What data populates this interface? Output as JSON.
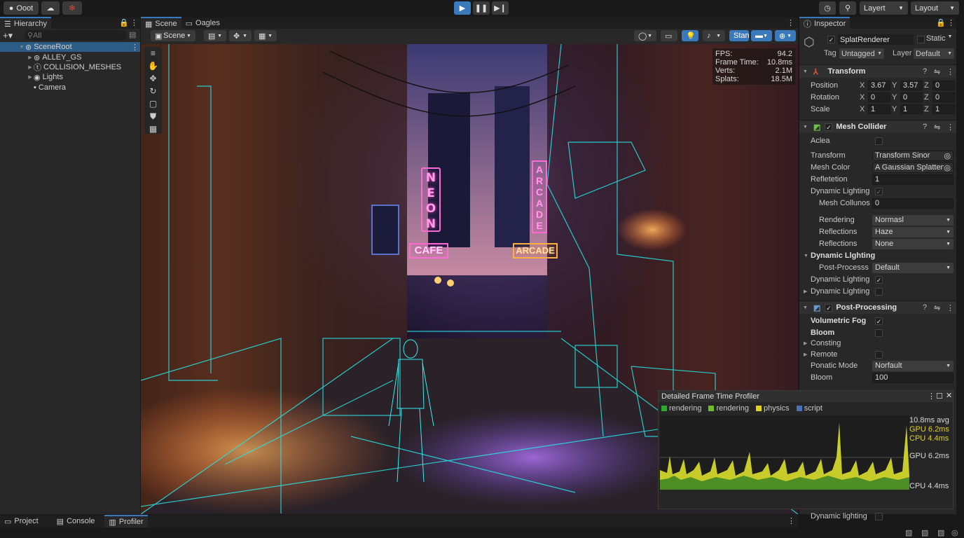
{
  "topbar": {
    "logo": "Ooot",
    "layer_dd": "Layert",
    "layout_dd": "Layout"
  },
  "hierarchy": {
    "tab": "Hierarchy",
    "search_placeholder": "All",
    "items": [
      {
        "label": "SceneRoot"
      },
      {
        "label": "ALLEY_GS"
      },
      {
        "label": "COLLISION_MESHES"
      },
      {
        "label": "Lights"
      },
      {
        "label": "Camera"
      }
    ]
  },
  "scene": {
    "tabs": [
      "Scene",
      "Oagles"
    ],
    "scene_dd": "Scene",
    "stan": "Stan",
    "stats": [
      {
        "k": "FPS:",
        "v": "94.2"
      },
      {
        "k": "Frame Time:",
        "v": "10.8ms"
      },
      {
        "k": "Verts:",
        "v": "2.1M"
      },
      {
        "k": "Splats:",
        "v": "18.5M"
      }
    ],
    "signs": {
      "neon": "NEON",
      "cafe": "CAFE",
      "arcade_v": "ARCADE",
      "arcade_h": "ARCADE"
    }
  },
  "inspector": {
    "tab": "Inspector",
    "object": "SplatRenderer",
    "static": "Static",
    "tag_label": "Tag",
    "tag": "Untagged",
    "layer_label": "Layer",
    "layer": "Default",
    "transform": {
      "title": "Transform",
      "rows": [
        {
          "label": "Position",
          "x": "3.67",
          "y": "3.57",
          "z": "0"
        },
        {
          "label": "Rotation",
          "x": "0",
          "y": "0",
          "z": "0"
        },
        {
          "label": "Scale",
          "x": "1",
          "y": "1",
          "z": "1"
        }
      ]
    },
    "mesh_collider": {
      "title": "Mesh Collider",
      "aclea": "Aclea",
      "transform_label": "Transform",
      "transform_value": "Transform Sinor",
      "mesh_color_label": "Mesh Color",
      "mesh_color_value": "A Gaussian Splatten",
      "refletetion_label": "Refletetion",
      "refletetion_value": "1",
      "dynamic_lighting": "Dynamic Lighting",
      "mesh_collunos_label": "Mesh Collunos",
      "mesh_collunos_value": "0",
      "rendering_label": "Rendering",
      "rendering_value": "Normasl",
      "reflections1_label": "Reflections",
      "reflections1_value": "Haze",
      "reflections2_label": "Reflections",
      "reflections2_value": "None",
      "dyn_group": "Dynamic Llghting",
      "post_label": "Post-Processs",
      "post_value": "Default",
      "dyn2": "Dynamic Lighting",
      "dyn3": "Dynamic Lighting"
    },
    "post_processing": {
      "title": "Post-Processing",
      "volumetric_fog": "Volumetric Fog",
      "bloom": "Bloom",
      "consting": "Consting",
      "remote": "Remote",
      "mode_label": "Ponatic Mode",
      "mode_value": "Norfault",
      "bloom2_label": "Bloom",
      "bloom2_value": "100"
    },
    "bottom": {
      "dyn_lighting": "Dynamic lighting"
    }
  },
  "profiler": {
    "title": "Detailed Frame Time Profiler",
    "legend": [
      {
        "name": "rendering",
        "color": "#2faa2f"
      },
      {
        "name": "rendering",
        "color": "#6cbf2a"
      },
      {
        "name": "physics",
        "color": "#e3d21c"
      },
      {
        "name": "script",
        "color": "#4c6fb5"
      }
    ],
    "labels": {
      "avg": "10.8ms avg",
      "gpu1": "GPU 6.2ms",
      "cpu1": "CPU 4.4ms",
      "gpu2": "GPU 6.2ms",
      "cpu2": "CPU 4.4ms"
    }
  },
  "bottombar": {
    "tabs": [
      "Project",
      "Console",
      "Profiler"
    ]
  }
}
